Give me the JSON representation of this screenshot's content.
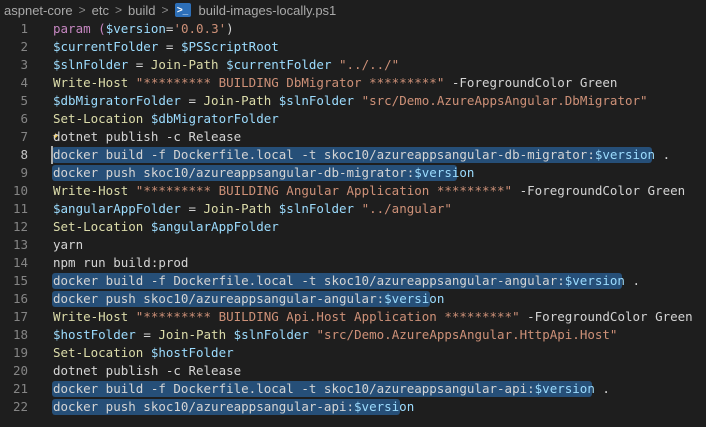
{
  "breadcrumb": {
    "items": [
      "aspnet-core",
      "etc",
      "build"
    ],
    "file_icon": "powershell-file-icon",
    "file_name": "build-images-locally.ps1",
    "separator": ">"
  },
  "editor": {
    "active_line": 8,
    "lines": [
      {
        "num": "1",
        "tokens": [
          {
            "t": "param (",
            "c": "kw"
          },
          {
            "t": "$version",
            "c": "var"
          },
          {
            "t": "=",
            "c": "plain"
          },
          {
            "t": "'0.0.3'",
            "c": "str"
          },
          {
            "t": ")",
            "c": "plain"
          }
        ]
      },
      {
        "num": "2",
        "tokens": [
          {
            "t": "$currentFolder",
            "c": "var"
          },
          {
            "t": " = ",
            "c": "plain"
          },
          {
            "t": "$PSScriptRoot",
            "c": "var"
          }
        ]
      },
      {
        "num": "3",
        "tokens": [
          {
            "t": "$slnFolder",
            "c": "var"
          },
          {
            "t": " = ",
            "c": "plain"
          },
          {
            "t": "Join-Path",
            "c": "cmd"
          },
          {
            "t": " ",
            "c": "plain"
          },
          {
            "t": "$currentFolder",
            "c": "var"
          },
          {
            "t": " ",
            "c": "plain"
          },
          {
            "t": "\"../../\"",
            "c": "str"
          }
        ]
      },
      {
        "num": "4",
        "tokens": [
          {
            "t": "Write-Host",
            "c": "cmd"
          },
          {
            "t": " ",
            "c": "plain"
          },
          {
            "t": "\"********* BUILDING DbMigrator *********\"",
            "c": "str"
          },
          {
            "t": " -ForegroundColor Green",
            "c": "plain"
          }
        ]
      },
      {
        "num": "5",
        "tokens": [
          {
            "t": "$dbMigratorFolder",
            "c": "var"
          },
          {
            "t": " = ",
            "c": "plain"
          },
          {
            "t": "Join-Path",
            "c": "cmd"
          },
          {
            "t": " ",
            "c": "plain"
          },
          {
            "t": "$slnFolder",
            "c": "var"
          },
          {
            "t": " ",
            "c": "plain"
          },
          {
            "t": "\"src/Demo.AzureAppsAngular.DbMigrator\"",
            "c": "str"
          }
        ]
      },
      {
        "num": "6",
        "tokens": [
          {
            "t": "Set-Location",
            "c": "cmd"
          },
          {
            "t": " ",
            "c": "plain"
          },
          {
            "t": "$dbMigratorFolder",
            "c": "var"
          }
        ]
      },
      {
        "num": "7",
        "bulb": true,
        "tokens": [
          {
            "t": "dotnet publish -c Release",
            "c": "plain"
          }
        ]
      },
      {
        "num": "8",
        "hl": true,
        "tokens": [
          {
            "t": "docker build -f Dockerfile.local -t skoc10/azureappsangular-db-migrator:",
            "c": "plain"
          },
          {
            "t": "$version",
            "c": "var"
          },
          {
            "t": " .",
            "c": "plain"
          }
        ]
      },
      {
        "num": "9",
        "hl": true,
        "tokens": [
          {
            "t": "docker push skoc10/azureappsangular-db-migrator:",
            "c": "plain"
          },
          {
            "t": "$version",
            "c": "var"
          }
        ]
      },
      {
        "num": "10",
        "tokens": [
          {
            "t": "Write-Host",
            "c": "cmd"
          },
          {
            "t": " ",
            "c": "plain"
          },
          {
            "t": "\"********* BUILDING Angular Application *********\"",
            "c": "str"
          },
          {
            "t": " -ForegroundColor Green",
            "c": "plain"
          }
        ]
      },
      {
        "num": "11",
        "tokens": [
          {
            "t": "$angularAppFolder",
            "c": "var"
          },
          {
            "t": " = ",
            "c": "plain"
          },
          {
            "t": "Join-Path",
            "c": "cmd"
          },
          {
            "t": " ",
            "c": "plain"
          },
          {
            "t": "$slnFolder",
            "c": "var"
          },
          {
            "t": " ",
            "c": "plain"
          },
          {
            "t": "\"../angular\"",
            "c": "str"
          }
        ]
      },
      {
        "num": "12",
        "tokens": [
          {
            "t": "Set-Location",
            "c": "cmd"
          },
          {
            "t": " ",
            "c": "plain"
          },
          {
            "t": "$angularAppFolder",
            "c": "var"
          }
        ]
      },
      {
        "num": "13",
        "tokens": [
          {
            "t": "yarn",
            "c": "plain"
          }
        ]
      },
      {
        "num": "14",
        "tokens": [
          {
            "t": "npm run build:prod",
            "c": "plain"
          }
        ]
      },
      {
        "num": "15",
        "hl": true,
        "tokens": [
          {
            "t": "docker build -f Dockerfile.local -t skoc10/azureappsangular-angular:",
            "c": "plain"
          },
          {
            "t": "$version",
            "c": "var"
          },
          {
            "t": " .",
            "c": "plain"
          }
        ]
      },
      {
        "num": "16",
        "hl": true,
        "tokens": [
          {
            "t": "docker push skoc10/azureappsangular-angular:",
            "c": "plain"
          },
          {
            "t": "$version",
            "c": "var"
          }
        ]
      },
      {
        "num": "17",
        "tokens": [
          {
            "t": "Write-Host",
            "c": "cmd"
          },
          {
            "t": " ",
            "c": "plain"
          },
          {
            "t": "\"********* BUILDING Api.Host Application *********\"",
            "c": "str"
          },
          {
            "t": " -ForegroundColor Green",
            "c": "plain"
          }
        ]
      },
      {
        "num": "18",
        "tokens": [
          {
            "t": "$hostFolder",
            "c": "var"
          },
          {
            "t": " = ",
            "c": "plain"
          },
          {
            "t": "Join-Path",
            "c": "cmd"
          },
          {
            "t": " ",
            "c": "plain"
          },
          {
            "t": "$slnFolder",
            "c": "var"
          },
          {
            "t": " ",
            "c": "plain"
          },
          {
            "t": "\"src/Demo.AzureAppsAngular.HttpApi.Host\"",
            "c": "str"
          }
        ]
      },
      {
        "num": "19",
        "tokens": [
          {
            "t": "Set-Location",
            "c": "cmd"
          },
          {
            "t": " ",
            "c": "plain"
          },
          {
            "t": "$hostFolder",
            "c": "var"
          }
        ]
      },
      {
        "num": "20",
        "tokens": [
          {
            "t": "dotnet publish -c Release",
            "c": "plain"
          }
        ]
      },
      {
        "num": "21",
        "hl": true,
        "tokens": [
          {
            "t": "docker build -f Dockerfile.local -t skoc10/azureappsangular-api:",
            "c": "plain"
          },
          {
            "t": "$version",
            "c": "var"
          },
          {
            "t": " .",
            "c": "plain"
          }
        ]
      },
      {
        "num": "22",
        "hl": true,
        "tokens": [
          {
            "t": "docker push skoc10/azureappsangular-api:",
            "c": "plain"
          },
          {
            "t": "$version",
            "c": "var"
          }
        ]
      }
    ]
  },
  "colors": {
    "background": "#1e1e1e",
    "selection": "#264f78",
    "keyword": "#c586c0",
    "variable": "#9cdcfe",
    "command": "#dcdcaa",
    "string": "#ce9178",
    "plain": "#d4d4d4",
    "line_number": "#858585"
  }
}
